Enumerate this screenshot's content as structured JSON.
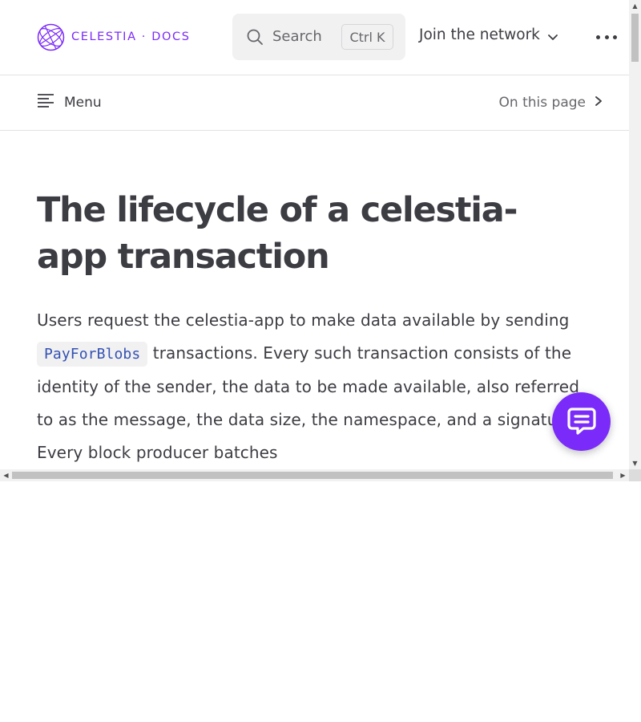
{
  "header": {
    "logo_text": "CELESTIA · DOCS",
    "search_label": "Search",
    "search_shortcut": "Ctrl K",
    "join_label": "Join the network"
  },
  "localnav": {
    "menu_label": "Menu",
    "on_this_page_label": "On this page"
  },
  "article": {
    "title": "The lifecycle of a celestia-app transaction",
    "para_before_code": "Users request the celestia-app to make data available by sending ",
    "code_token": "PayForBlobs",
    "para_after_code": " transactions. Every such transaction consists of the identity of the sender, the data to be made available, also referred to as the message, the data size, the namespace, and a signature. Every block producer batches"
  },
  "colors": {
    "brand": "#7b2bf9",
    "text": "#3c3c43",
    "code_text": "#3451b2"
  },
  "icons": [
    "celestia-logo-icon",
    "search-icon",
    "chevron-down-icon",
    "more-dots-icon",
    "menu-lines-icon",
    "chevron-right-icon",
    "chat-icon"
  ]
}
